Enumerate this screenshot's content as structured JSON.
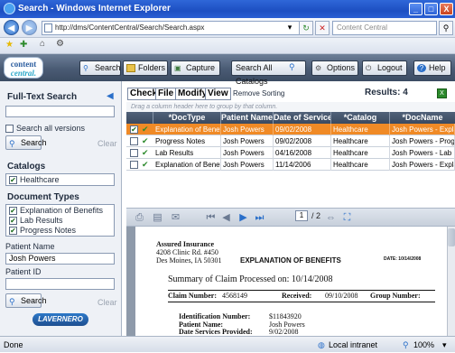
{
  "window": {
    "title": "Search - Windows Internet Explorer",
    "min": "_",
    "max": "□",
    "close": "X"
  },
  "browser": {
    "back": "◀",
    "forward": "▶",
    "url": "http://dms/ContentCentral/Search/Search.aspx",
    "search_placeholder": "Content Central",
    "fav_star": "★",
    "add_fav": "✚",
    "home": "⌂",
    "tools": "⚙",
    "dropdown": "▾",
    "refresh": "↻",
    "stop": "✕",
    "search_go": "⚲"
  },
  "logo": {
    "line1": "content",
    "line2": "central."
  },
  "toolbar": {
    "search": "Search",
    "folders": "Folders",
    "capture": "Capture",
    "search_all": "Search All Catalogs",
    "options": "Options",
    "logout": "Logout",
    "help": "Help"
  },
  "left": {
    "fulltext_title": "Full-Text Search",
    "search_all_versions": "Search all versions",
    "search_btn": "Search",
    "clear": "Clear",
    "catalogs_title": "Catalogs",
    "catalogs": [
      {
        "label": "Healthcare",
        "checked": "✔"
      }
    ],
    "doctypes_title": "Document Types",
    "doctypes": [
      {
        "label": "Explanation of Benefits",
        "checked": "✔"
      },
      {
        "label": "Lab Results",
        "checked": "✔"
      },
      {
        "label": "Progress Notes",
        "checked": "✔"
      }
    ],
    "patient_name_label": "Patient Name",
    "patient_name_value": "Josh Powers",
    "patient_id_label": "Patient ID",
    "patient_id_value": "",
    "search_btn2": "Search",
    "clear2": "Clear",
    "vendor_logo": "LAVERNERO"
  },
  "grid": {
    "menu": [
      "Check",
      "File",
      "Modify",
      "View"
    ],
    "remove_sorting": "Remove Sorting",
    "results": "Results: 4",
    "export_icon": "X",
    "hint": "Drag a column header here to group by that column.",
    "columns": [
      "*DocType",
      "Patient Name",
      "Date of Service ▼",
      "*Catalog",
      "*DocName"
    ],
    "rows": [
      {
        "check": "✔",
        "doctype": "Explanation of Benefits",
        "patient": "Josh Powers",
        "date": "09/02/2008",
        "catalog": "Healthcare",
        "docname": "Josh Powers - Explanat"
      },
      {
        "check": "",
        "doctype": "Progress Notes",
        "patient": "Josh Powers",
        "date": "09/02/2008",
        "catalog": "Healthcare",
        "docname": "Josh Powers - Progress"
      },
      {
        "check": "",
        "doctype": "Lab Results",
        "patient": "Josh Powers",
        "date": "04/16/2008",
        "catalog": "Healthcare",
        "docname": "Josh Powers - Lab Res"
      },
      {
        "check": "",
        "doctype": "Explanation of Benefits",
        "patient": "Josh Powers",
        "date": "11/14/2006",
        "catalog": "Healthcare",
        "docname": "Josh Powers - Explanat"
      }
    ]
  },
  "viewer": {
    "page": "1",
    "page_total": "/ 2"
  },
  "doc": {
    "company": "Assured Insurance",
    "addr1": "4208 Clinic Rd. #450",
    "addr2": "Des Moines, IA 50301",
    "eob": "EXPLANATION OF BENEFITS",
    "date_label": "DATE: 10/14/2008",
    "summary": "Summary of Claim Processed on:  10/14/2008",
    "claim_label": "Claim Number:",
    "claim_value": "4568149",
    "received_label": "Received:",
    "received_value": "09/10/2008",
    "group_label": "Group Number:",
    "ident_label": "Identification Number:",
    "ident_value": "$11843920",
    "pname_label": "Patient Name:",
    "pname_value": "Josh Powers",
    "dates_label": "Date Services Provided:",
    "dates_value": "9/02/2008"
  },
  "status": {
    "left": "Done",
    "zone": "Local intranet",
    "zoom": "100%"
  }
}
